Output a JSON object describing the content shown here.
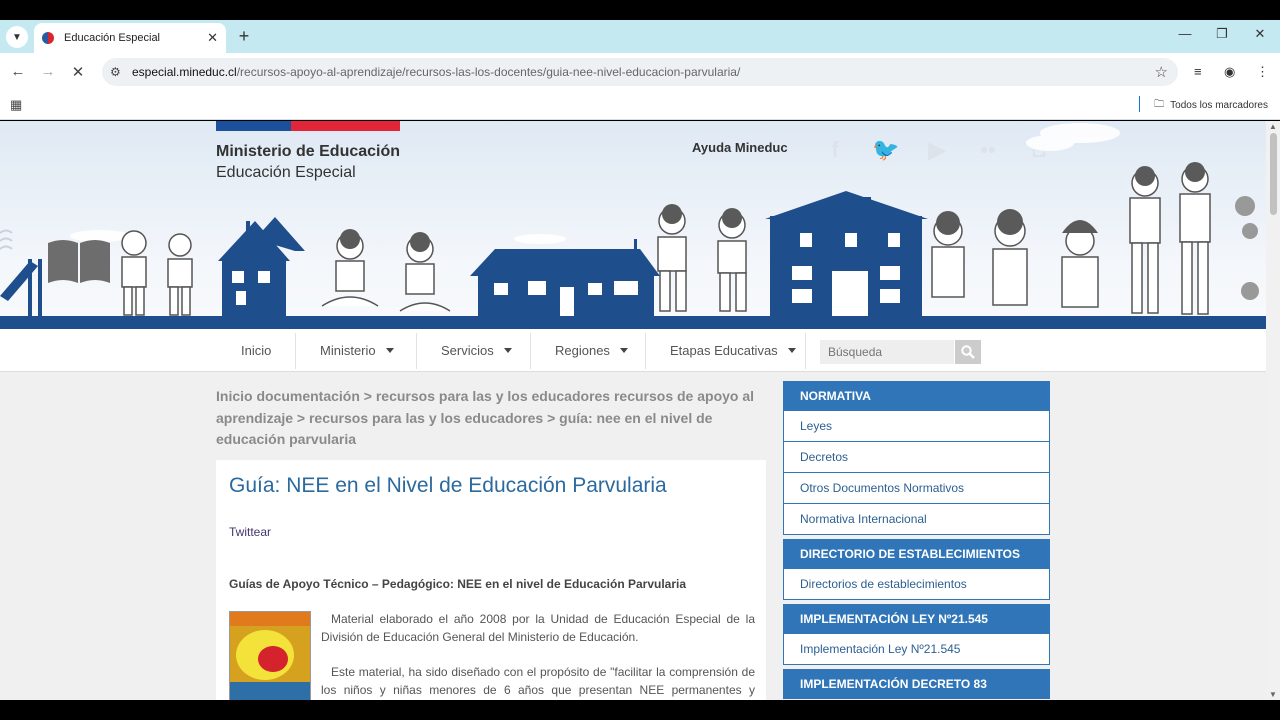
{
  "browser": {
    "tab_title": "Educación Especial",
    "url_domain": "especial.mineduc.cl",
    "url_path": "/recursos-apoyo-al-aprendizaje/recursos-las-los-docentes/guia-nee-nivel-educacion-parvularia/",
    "bookmarks_all_label": "Todos los marcadores"
  },
  "header": {
    "org_name": "Ministerio de Educación",
    "org_sub": "Educación Especial",
    "help_link": "Ayuda Mineduc"
  },
  "nav": {
    "items": [
      {
        "label": "Inicio"
      },
      {
        "label": "Ministerio"
      },
      {
        "label": "Servicios"
      },
      {
        "label": "Regiones"
      },
      {
        "label": "Etapas Educativas"
      }
    ],
    "search_placeholder": "Búsqueda"
  },
  "breadcrumb": "Inicio documentación > recursos para las y los educadores recursos de apoyo al aprendizaje > recursos para las y los educadores > guía: nee en el nivel de educación parvularia",
  "article": {
    "title": "Guía: NEE en el Nivel de Educación Parvularia",
    "twitter_label": "Twittear",
    "subheading": "Guías de Apoyo Técnico – Pedagógico: NEE en el nivel de Educación Parvularia",
    "paragraph1": "Material elaborado el año 2008 por la Unidad de Educación Especial de la División de Educación General del Ministerio de Educación.",
    "paragraph2": "Este material, ha sido diseñado con el propósito de \"facilitar la comprensión de los niños y niñas menores de 6 años que presentan NEE permanentes y transitorias de"
  },
  "sidebar": {
    "sections": [
      {
        "title": "NORMATIVA",
        "items": [
          "Leyes",
          "Decretos",
          "Otros Documentos Normativos",
          "Normativa Internacional"
        ]
      },
      {
        "title": "DIRECTORIO DE ESTABLECIMIENTOS",
        "items": [
          "Directorios de establecimientos"
        ]
      },
      {
        "title": "IMPLEMENTACIÓN LEY Nº21.545",
        "items": [
          "Implementación Ley Nº21.545"
        ]
      },
      {
        "title": "IMPLEMENTACIÓN DECRETO 83",
        "items": []
      }
    ]
  },
  "colors": {
    "brand_blue": "#1e4f8c",
    "sidebar_blue": "#2f75b8",
    "flag_red": "#e2263a"
  }
}
